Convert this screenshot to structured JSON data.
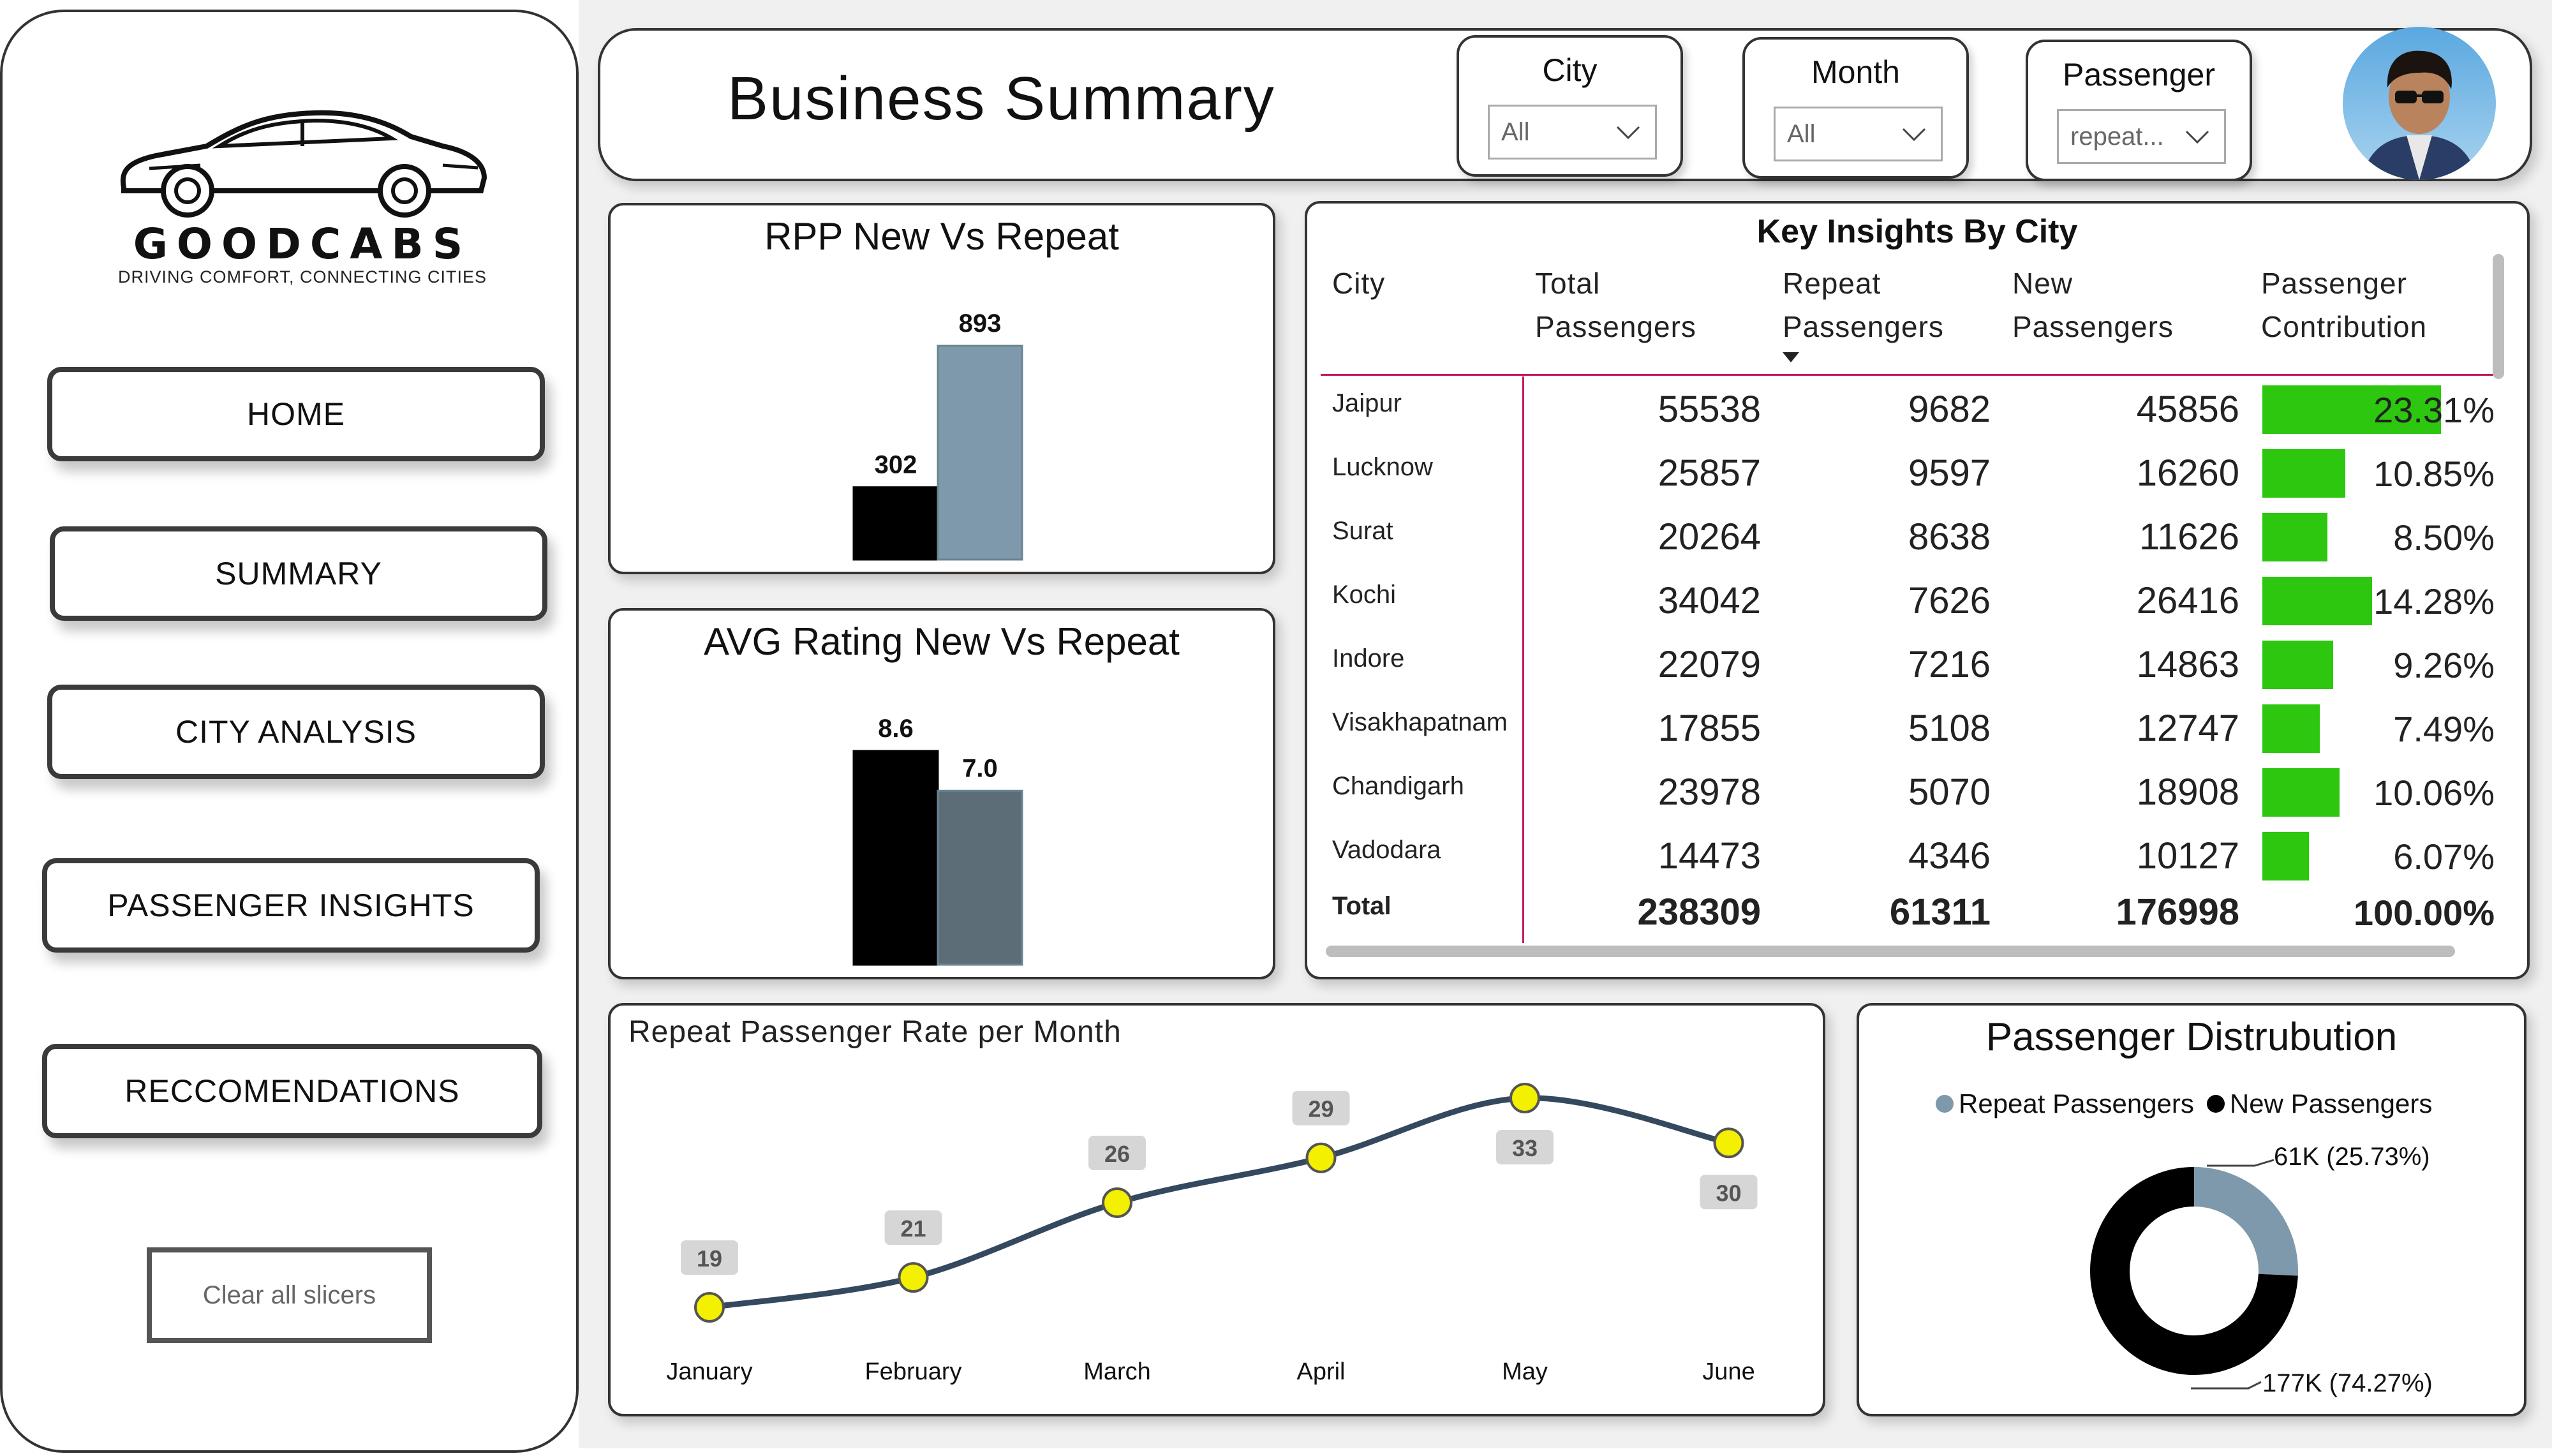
{
  "sidebar": {
    "brand": "GOODCABS",
    "tagline": "DRIVING COMFORT, CONNECTING CITIES",
    "nav": [
      {
        "label": "HOME"
      },
      {
        "label": "SUMMARY"
      },
      {
        "label": "CITY ANALYSIS"
      },
      {
        "label": "PASSENGER INSIGHTS"
      },
      {
        "label": "RECCOMENDATIONS"
      }
    ],
    "clear_label": "Clear all slicers"
  },
  "header": {
    "title": "Business Summary",
    "slicers": [
      {
        "label": "City",
        "value": "All"
      },
      {
        "label": "Month",
        "value": "All"
      },
      {
        "label": "Passenger",
        "value": "repeat..."
      }
    ]
  },
  "rpp": {
    "title": "RPP New Vs Repeat",
    "chart_data": {
      "type": "bar",
      "categories": [
        "",
        ""
      ],
      "values": [
        302,
        893
      ],
      "colors": [
        "#000000",
        "#7e99ab"
      ],
      "ylim": [
        0,
        893
      ]
    }
  },
  "rating": {
    "title": "AVG Rating New Vs Repeat",
    "chart_data": {
      "type": "bar",
      "categories": [
        "",
        ""
      ],
      "values": [
        8.6,
        7.0
      ],
      "labels": [
        "8.6",
        "7.0"
      ],
      "colors": [
        "#000000",
        "#5d6d77"
      ],
      "ylim": [
        0,
        8.6
      ]
    }
  },
  "table": {
    "title": "Key Insights By City",
    "headers": {
      "city": "City",
      "total": [
        "Total",
        "Passengers"
      ],
      "repeat": [
        "Repeat",
        "Passengers"
      ],
      "new": "New Passengers",
      "contrib": [
        "Passenger",
        "Contribution"
      ]
    },
    "rows": [
      {
        "city": "Jaipur",
        "total": "55538",
        "repeat": "9682",
        "new": "45856",
        "contrib": "23.31%",
        "pct": 23.31
      },
      {
        "city": "Lucknow",
        "total": "25857",
        "repeat": "9597",
        "new": "16260",
        "contrib": "10.85%",
        "pct": 10.85
      },
      {
        "city": "Surat",
        "total": "20264",
        "repeat": "8638",
        "new": "11626",
        "contrib": "8.50%",
        "pct": 8.5
      },
      {
        "city": "Kochi",
        "total": "34042",
        "repeat": "7626",
        "new": "26416",
        "contrib": "14.28%",
        "pct": 14.28
      },
      {
        "city": "Indore",
        "total": "22079",
        "repeat": "7216",
        "new": "14863",
        "contrib": "9.26%",
        "pct": 9.26
      },
      {
        "city": "Visakhapatnam",
        "total": "17855",
        "repeat": "5108",
        "new": "12747",
        "contrib": "7.49%",
        "pct": 7.49
      },
      {
        "city": "Chandigarh",
        "total": "23978",
        "repeat": "5070",
        "new": "18908",
        "contrib": "10.06%",
        "pct": 10.06
      },
      {
        "city": "Vadodara",
        "total": "14473",
        "repeat": "4346",
        "new": "10127",
        "contrib": "6.07%",
        "pct": 6.07
      }
    ],
    "total": {
      "city": "Total",
      "total": "238309",
      "repeat": "61311",
      "new": "176998",
      "contrib": "100.00%"
    }
  },
  "line": {
    "title": "Repeat Passenger Rate per Month",
    "chart_data": {
      "type": "line",
      "categories": [
        "January",
        "February",
        "March",
        "April",
        "May",
        "June"
      ],
      "values": [
        19,
        21,
        26,
        29,
        33,
        30
      ],
      "ylim": [
        15,
        35
      ],
      "line_color": "#34495e",
      "marker_color": "#f3f000"
    }
  },
  "donut": {
    "title": "Passenger Distrubution",
    "legend": [
      "Repeat Passengers",
      "New Passengers"
    ],
    "chart_data": {
      "type": "pie",
      "categories": [
        "Repeat Passengers",
        "New Passengers"
      ],
      "values": [
        25.73,
        74.27
      ],
      "labels": [
        "61K (25.73%)",
        "177K (74.27%)"
      ],
      "colors": [
        "#7e99ab",
        "#000000"
      ]
    }
  }
}
